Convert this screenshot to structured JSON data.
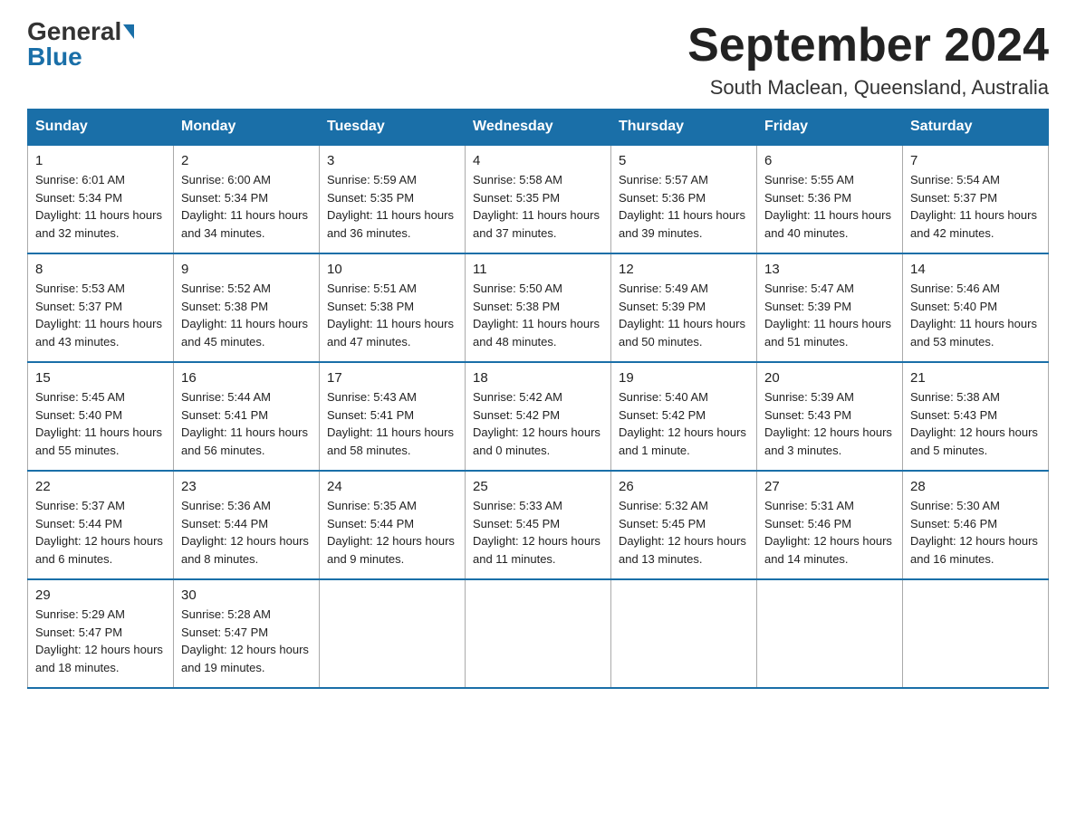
{
  "logo": {
    "line1": "General",
    "arrow": "▶",
    "line2": "Blue"
  },
  "title": "September 2024",
  "subtitle": "South Maclean, Queensland, Australia",
  "days": [
    "Sunday",
    "Monday",
    "Tuesday",
    "Wednesday",
    "Thursday",
    "Friday",
    "Saturday"
  ],
  "weeks": [
    [
      {
        "day": "1",
        "sunrise": "6:01 AM",
        "sunset": "5:34 PM",
        "daylight": "11 hours and 32 minutes."
      },
      {
        "day": "2",
        "sunrise": "6:00 AM",
        "sunset": "5:34 PM",
        "daylight": "11 hours and 34 minutes."
      },
      {
        "day": "3",
        "sunrise": "5:59 AM",
        "sunset": "5:35 PM",
        "daylight": "11 hours and 36 minutes."
      },
      {
        "day": "4",
        "sunrise": "5:58 AM",
        "sunset": "5:35 PM",
        "daylight": "11 hours and 37 minutes."
      },
      {
        "day": "5",
        "sunrise": "5:57 AM",
        "sunset": "5:36 PM",
        "daylight": "11 hours and 39 minutes."
      },
      {
        "day": "6",
        "sunrise": "5:55 AM",
        "sunset": "5:36 PM",
        "daylight": "11 hours and 40 minutes."
      },
      {
        "day": "7",
        "sunrise": "5:54 AM",
        "sunset": "5:37 PM",
        "daylight": "11 hours and 42 minutes."
      }
    ],
    [
      {
        "day": "8",
        "sunrise": "5:53 AM",
        "sunset": "5:37 PM",
        "daylight": "11 hours and 43 minutes."
      },
      {
        "day": "9",
        "sunrise": "5:52 AM",
        "sunset": "5:38 PM",
        "daylight": "11 hours and 45 minutes."
      },
      {
        "day": "10",
        "sunrise": "5:51 AM",
        "sunset": "5:38 PM",
        "daylight": "11 hours and 47 minutes."
      },
      {
        "day": "11",
        "sunrise": "5:50 AM",
        "sunset": "5:38 PM",
        "daylight": "11 hours and 48 minutes."
      },
      {
        "day": "12",
        "sunrise": "5:49 AM",
        "sunset": "5:39 PM",
        "daylight": "11 hours and 50 minutes."
      },
      {
        "day": "13",
        "sunrise": "5:47 AM",
        "sunset": "5:39 PM",
        "daylight": "11 hours and 51 minutes."
      },
      {
        "day": "14",
        "sunrise": "5:46 AM",
        "sunset": "5:40 PM",
        "daylight": "11 hours and 53 minutes."
      }
    ],
    [
      {
        "day": "15",
        "sunrise": "5:45 AM",
        "sunset": "5:40 PM",
        "daylight": "11 hours and 55 minutes."
      },
      {
        "day": "16",
        "sunrise": "5:44 AM",
        "sunset": "5:41 PM",
        "daylight": "11 hours and 56 minutes."
      },
      {
        "day": "17",
        "sunrise": "5:43 AM",
        "sunset": "5:41 PM",
        "daylight": "11 hours and 58 minutes."
      },
      {
        "day": "18",
        "sunrise": "5:42 AM",
        "sunset": "5:42 PM",
        "daylight": "12 hours and 0 minutes."
      },
      {
        "day": "19",
        "sunrise": "5:40 AM",
        "sunset": "5:42 PM",
        "daylight": "12 hours and 1 minute."
      },
      {
        "day": "20",
        "sunrise": "5:39 AM",
        "sunset": "5:43 PM",
        "daylight": "12 hours and 3 minutes."
      },
      {
        "day": "21",
        "sunrise": "5:38 AM",
        "sunset": "5:43 PM",
        "daylight": "12 hours and 5 minutes."
      }
    ],
    [
      {
        "day": "22",
        "sunrise": "5:37 AM",
        "sunset": "5:44 PM",
        "daylight": "12 hours and 6 minutes."
      },
      {
        "day": "23",
        "sunrise": "5:36 AM",
        "sunset": "5:44 PM",
        "daylight": "12 hours and 8 minutes."
      },
      {
        "day": "24",
        "sunrise": "5:35 AM",
        "sunset": "5:44 PM",
        "daylight": "12 hours and 9 minutes."
      },
      {
        "day": "25",
        "sunrise": "5:33 AM",
        "sunset": "5:45 PM",
        "daylight": "12 hours and 11 minutes."
      },
      {
        "day": "26",
        "sunrise": "5:32 AM",
        "sunset": "5:45 PM",
        "daylight": "12 hours and 13 minutes."
      },
      {
        "day": "27",
        "sunrise": "5:31 AM",
        "sunset": "5:46 PM",
        "daylight": "12 hours and 14 minutes."
      },
      {
        "day": "28",
        "sunrise": "5:30 AM",
        "sunset": "5:46 PM",
        "daylight": "12 hours and 16 minutes."
      }
    ],
    [
      {
        "day": "29",
        "sunrise": "5:29 AM",
        "sunset": "5:47 PM",
        "daylight": "12 hours and 18 minutes."
      },
      {
        "day": "30",
        "sunrise": "5:28 AM",
        "sunset": "5:47 PM",
        "daylight": "12 hours and 19 minutes."
      },
      null,
      null,
      null,
      null,
      null
    ]
  ],
  "labels": {
    "sunrise": "Sunrise:",
    "sunset": "Sunset:",
    "daylight": "Daylight:"
  }
}
